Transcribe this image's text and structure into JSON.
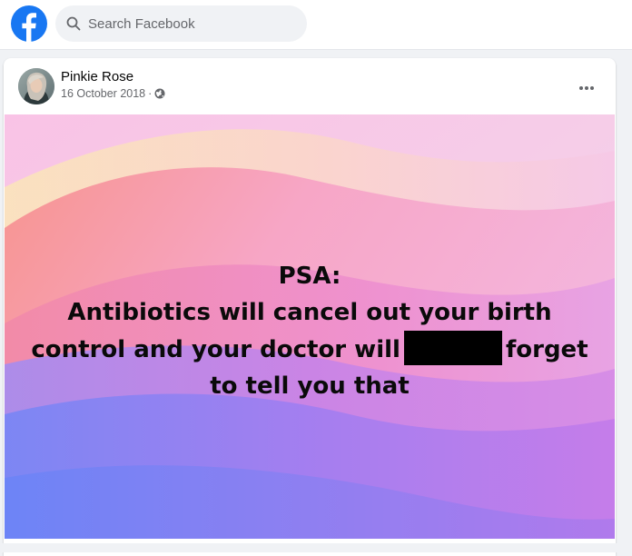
{
  "search": {
    "placeholder": "Search Facebook",
    "icon": "search-icon"
  },
  "brand": {
    "logo": "facebook-logo",
    "color": "#1877f2"
  },
  "post": {
    "author": "Pinkie Rose",
    "date": "16 October 2018",
    "separator": "·",
    "audience_icon": "globe-icon",
    "menu_icon": "more-options-icon",
    "image": {
      "line1": "PSA:",
      "line2": "Antibiotics will cancel out your birth",
      "line3_before": "control and your doctor will",
      "line3_after": "forget",
      "line4": "to tell you that",
      "redacted": true
    }
  }
}
